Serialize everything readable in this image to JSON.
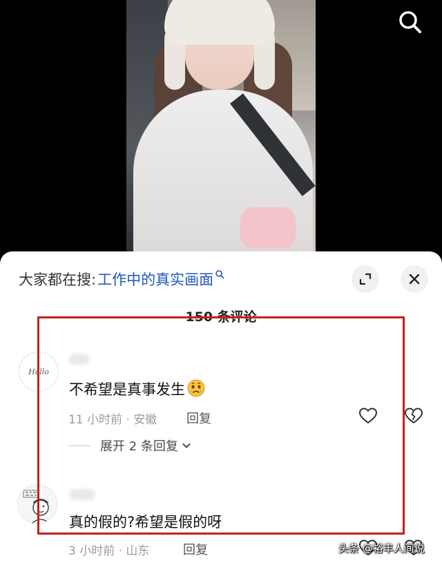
{
  "search_bar": {
    "prefix": "大家都在搜:",
    "term": "工作中的真实画面"
  },
  "comments_header": {
    "count_label": "150 条评论"
  },
  "comments": [
    {
      "avatar_text": "Hello",
      "text": "不希望是真事发生",
      "emoji": "crying-face-emoji",
      "meta": "11 小时前 · 安徽",
      "reply_label": "回复",
      "expand_replies_label": "展开 2 条回复"
    },
    {
      "text": "真的假的?希望是假的呀",
      "meta": "3 小时前 · 山东",
      "reply_label": "回复"
    }
  ],
  "icons": {
    "search": "search-icon",
    "expand": "expand-icon",
    "close": "close-icon",
    "like": "heart-outline-icon",
    "dislike": "broken-heart-icon",
    "chevron": "chevron-down-icon"
  },
  "colors": {
    "link": "#1f57b8",
    "highlight_border": "#c41f1f"
  },
  "watermark": "头条 @裕丰人间说"
}
